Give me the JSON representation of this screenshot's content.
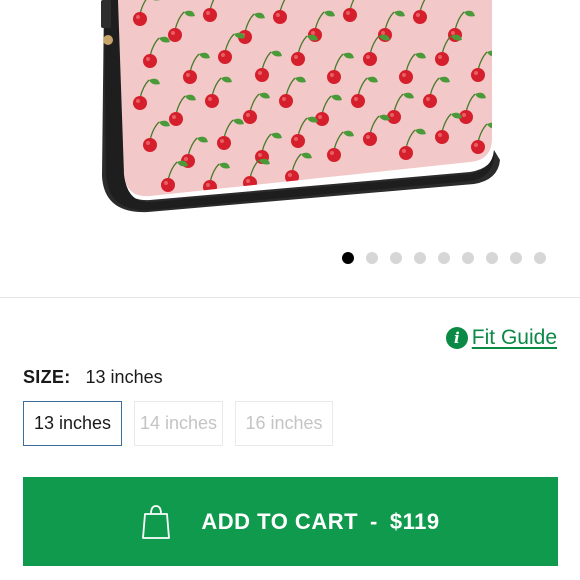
{
  "gallery": {
    "image_alt": "Cherry print laptop sleeve",
    "slide_count": 9,
    "active_slide": 1
  },
  "fit_guide": {
    "label": "Fit Guide",
    "icon": "info-icon"
  },
  "size": {
    "key_label": "SIZE:",
    "selected_value": "13 inches",
    "options": [
      "13 inches",
      "14 inches",
      "16 inches"
    ]
  },
  "cart": {
    "label": "ADD TO CART",
    "separator": "-",
    "price": "$119",
    "icon": "shopping-bag-icon"
  },
  "colors": {
    "accent_green": "#0f9a4e",
    "link_green": "#0b8a45",
    "selected_border": "#3b6e9c",
    "case_pink": "#f2c8c8",
    "cherry_red": "#d61f2c",
    "leaf_green": "#4a9a3a",
    "case_edge": "#2b2b2b"
  }
}
